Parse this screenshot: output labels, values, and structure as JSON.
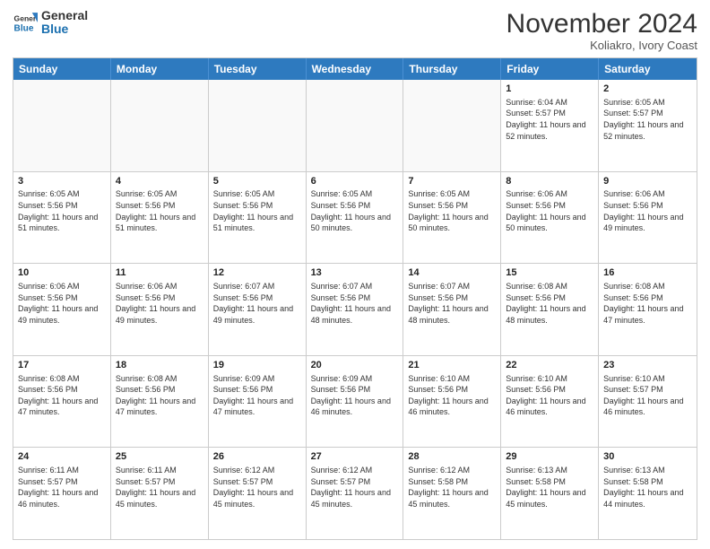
{
  "header": {
    "logo_line1": "General",
    "logo_line2": "Blue",
    "month": "November 2024",
    "location": "Koliakro, Ivory Coast"
  },
  "days_of_week": [
    "Sunday",
    "Monday",
    "Tuesday",
    "Wednesday",
    "Thursday",
    "Friday",
    "Saturday"
  ],
  "weeks": [
    [
      {
        "day": "",
        "content": ""
      },
      {
        "day": "",
        "content": ""
      },
      {
        "day": "",
        "content": ""
      },
      {
        "day": "",
        "content": ""
      },
      {
        "day": "",
        "content": ""
      },
      {
        "day": "1",
        "content": "Sunrise: 6:04 AM\nSunset: 5:57 PM\nDaylight: 11 hours\nand 52 minutes."
      },
      {
        "day": "2",
        "content": "Sunrise: 6:05 AM\nSunset: 5:57 PM\nDaylight: 11 hours\nand 52 minutes."
      }
    ],
    [
      {
        "day": "3",
        "content": "Sunrise: 6:05 AM\nSunset: 5:56 PM\nDaylight: 11 hours\nand 51 minutes."
      },
      {
        "day": "4",
        "content": "Sunrise: 6:05 AM\nSunset: 5:56 PM\nDaylight: 11 hours\nand 51 minutes."
      },
      {
        "day": "5",
        "content": "Sunrise: 6:05 AM\nSunset: 5:56 PM\nDaylight: 11 hours\nand 51 minutes."
      },
      {
        "day": "6",
        "content": "Sunrise: 6:05 AM\nSunset: 5:56 PM\nDaylight: 11 hours\nand 50 minutes."
      },
      {
        "day": "7",
        "content": "Sunrise: 6:05 AM\nSunset: 5:56 PM\nDaylight: 11 hours\nand 50 minutes."
      },
      {
        "day": "8",
        "content": "Sunrise: 6:06 AM\nSunset: 5:56 PM\nDaylight: 11 hours\nand 50 minutes."
      },
      {
        "day": "9",
        "content": "Sunrise: 6:06 AM\nSunset: 5:56 PM\nDaylight: 11 hours\nand 49 minutes."
      }
    ],
    [
      {
        "day": "10",
        "content": "Sunrise: 6:06 AM\nSunset: 5:56 PM\nDaylight: 11 hours\nand 49 minutes."
      },
      {
        "day": "11",
        "content": "Sunrise: 6:06 AM\nSunset: 5:56 PM\nDaylight: 11 hours\nand 49 minutes."
      },
      {
        "day": "12",
        "content": "Sunrise: 6:07 AM\nSunset: 5:56 PM\nDaylight: 11 hours\nand 49 minutes."
      },
      {
        "day": "13",
        "content": "Sunrise: 6:07 AM\nSunset: 5:56 PM\nDaylight: 11 hours\nand 48 minutes."
      },
      {
        "day": "14",
        "content": "Sunrise: 6:07 AM\nSunset: 5:56 PM\nDaylight: 11 hours\nand 48 minutes."
      },
      {
        "day": "15",
        "content": "Sunrise: 6:08 AM\nSunset: 5:56 PM\nDaylight: 11 hours\nand 48 minutes."
      },
      {
        "day": "16",
        "content": "Sunrise: 6:08 AM\nSunset: 5:56 PM\nDaylight: 11 hours\nand 47 minutes."
      }
    ],
    [
      {
        "day": "17",
        "content": "Sunrise: 6:08 AM\nSunset: 5:56 PM\nDaylight: 11 hours\nand 47 minutes."
      },
      {
        "day": "18",
        "content": "Sunrise: 6:08 AM\nSunset: 5:56 PM\nDaylight: 11 hours\nand 47 minutes."
      },
      {
        "day": "19",
        "content": "Sunrise: 6:09 AM\nSunset: 5:56 PM\nDaylight: 11 hours\nand 47 minutes."
      },
      {
        "day": "20",
        "content": "Sunrise: 6:09 AM\nSunset: 5:56 PM\nDaylight: 11 hours\nand 46 minutes."
      },
      {
        "day": "21",
        "content": "Sunrise: 6:10 AM\nSunset: 5:56 PM\nDaylight: 11 hours\nand 46 minutes."
      },
      {
        "day": "22",
        "content": "Sunrise: 6:10 AM\nSunset: 5:56 PM\nDaylight: 11 hours\nand 46 minutes."
      },
      {
        "day": "23",
        "content": "Sunrise: 6:10 AM\nSunset: 5:57 PM\nDaylight: 11 hours\nand 46 minutes."
      }
    ],
    [
      {
        "day": "24",
        "content": "Sunrise: 6:11 AM\nSunset: 5:57 PM\nDaylight: 11 hours\nand 46 minutes."
      },
      {
        "day": "25",
        "content": "Sunrise: 6:11 AM\nSunset: 5:57 PM\nDaylight: 11 hours\nand 45 minutes."
      },
      {
        "day": "26",
        "content": "Sunrise: 6:12 AM\nSunset: 5:57 PM\nDaylight: 11 hours\nand 45 minutes."
      },
      {
        "day": "27",
        "content": "Sunrise: 6:12 AM\nSunset: 5:57 PM\nDaylight: 11 hours\nand 45 minutes."
      },
      {
        "day": "28",
        "content": "Sunrise: 6:12 AM\nSunset: 5:58 PM\nDaylight: 11 hours\nand 45 minutes."
      },
      {
        "day": "29",
        "content": "Sunrise: 6:13 AM\nSunset: 5:58 PM\nDaylight: 11 hours\nand 45 minutes."
      },
      {
        "day": "30",
        "content": "Sunrise: 6:13 AM\nSunset: 5:58 PM\nDaylight: 11 hours\nand 44 minutes."
      }
    ]
  ]
}
